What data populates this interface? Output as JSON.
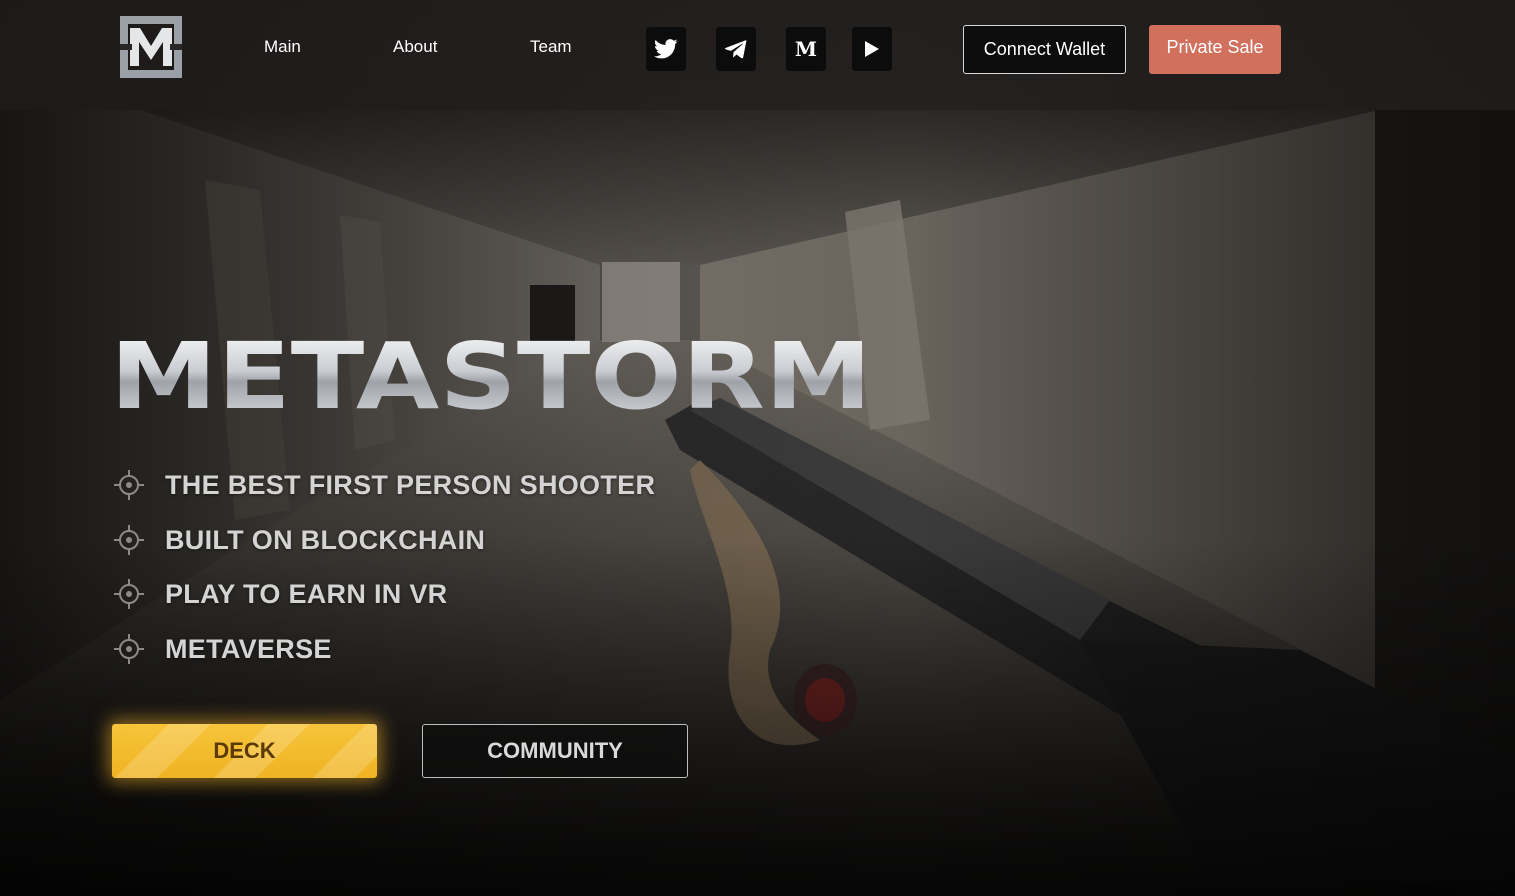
{
  "header": {
    "logo_icon": "metastorm-m-logo-icon",
    "nav": [
      {
        "label": "Main"
      },
      {
        "label": "About"
      },
      {
        "label": "Team"
      }
    ],
    "socials": [
      {
        "icon": "twitter-icon"
      },
      {
        "icon": "telegram-icon"
      },
      {
        "icon": "medium-icon",
        "glyph": "M"
      },
      {
        "icon": "youtube-play-icon"
      }
    ],
    "connect_wallet_label": "Connect Wallet",
    "private_sale_label": "Private Sale"
  },
  "hero": {
    "title": "METASTORM",
    "features": [
      "THE BEST FIRST PERSON SHOOTER",
      "BUILT ON BLOCKCHAIN",
      "PLAY TO EARN IN VR",
      "METAVERSE"
    ],
    "deck_label": "DECK",
    "community_label": "COMMUNITY"
  },
  "colors": {
    "accent_orange": "#d2705e",
    "deck_yellow": "#f7c43a",
    "header_bg": "#1c1a18"
  }
}
